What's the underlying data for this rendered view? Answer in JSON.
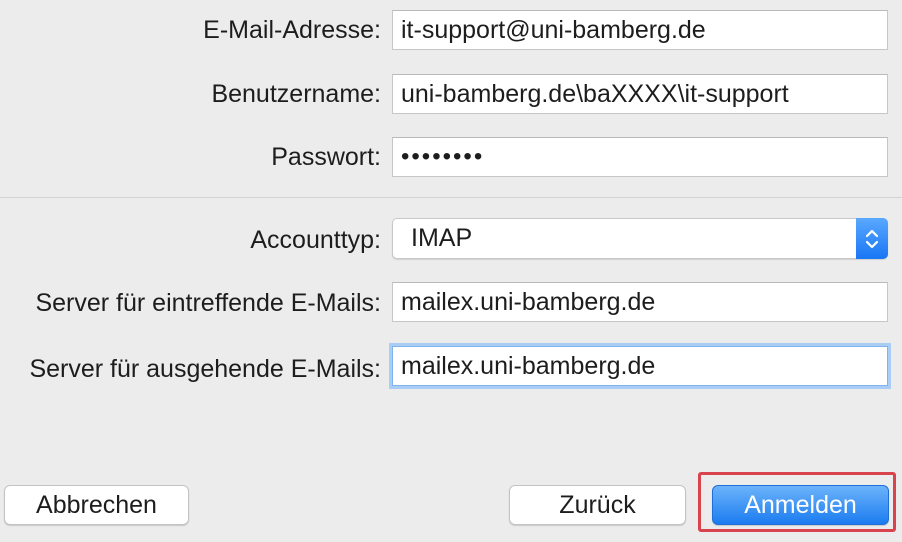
{
  "form": {
    "email": {
      "label": "E-Mail-Adresse:",
      "value": "it-support@uni-bamberg.de"
    },
    "username": {
      "label": "Benutzername:",
      "value": "uni-bamberg.de\\baXXXX\\it-support"
    },
    "password": {
      "label": "Passwort:",
      "value": "••••••••"
    },
    "account_type": {
      "label": "Accounttyp:",
      "value": "IMAP"
    },
    "incoming_server": {
      "label": "Server für eintreffende E-Mails:",
      "value": "mailex.uni-bamberg.de"
    },
    "outgoing_server": {
      "label": "Server für ausgehende E-Mails:",
      "value": "mailex.uni-bamberg.de"
    }
  },
  "buttons": {
    "cancel": "Abbrechen",
    "back": "Zurück",
    "sign_in": "Anmelden"
  },
  "colors": {
    "accent": "#1b7cf0",
    "highlight_frame": "#d9434e",
    "focus_ring": "#a9cdf5"
  },
  "icons": {
    "account_type_stepper": "up-down-chevron-icon"
  }
}
